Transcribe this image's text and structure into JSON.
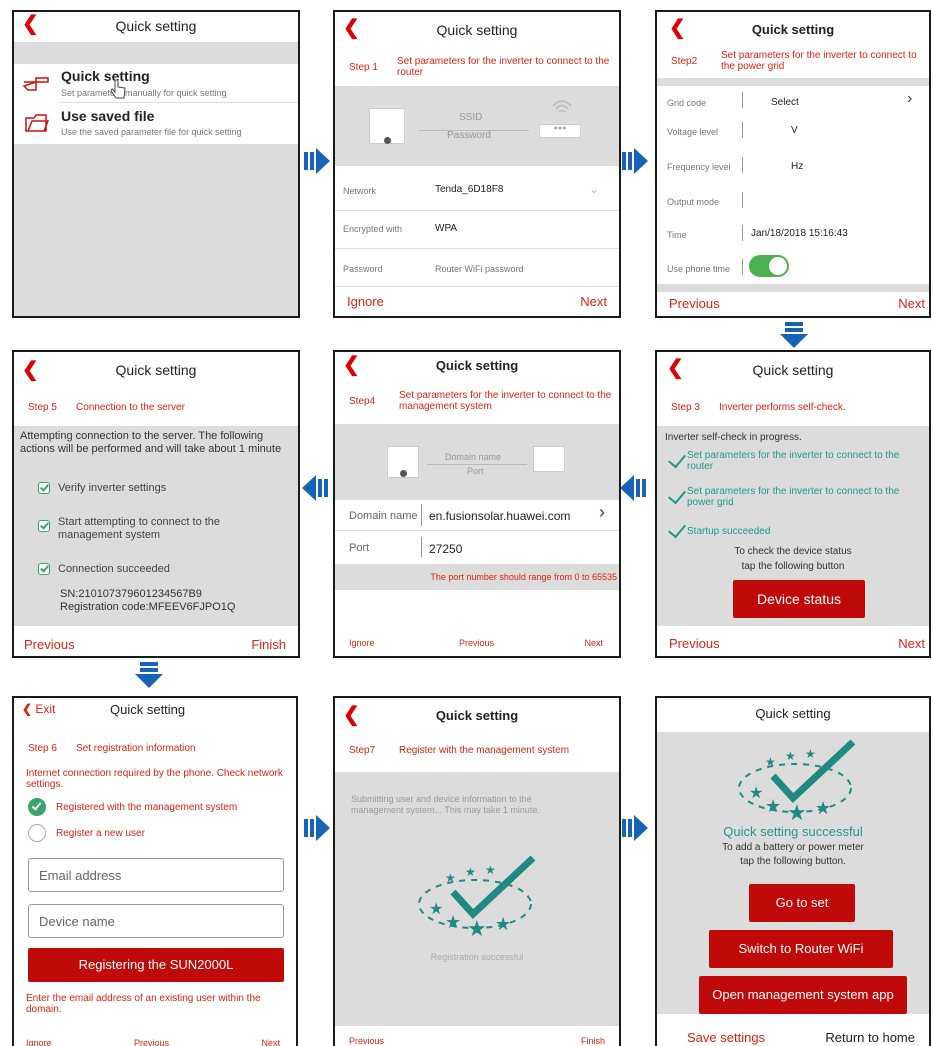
{
  "colors": {
    "accent": "#d21",
    "brand_red": "#c00a0a",
    "teal": "#1e9a8a",
    "toggle_green": "#4cb050",
    "arrow_blue": "#1664b8"
  },
  "s1": {
    "title": "Quick setting",
    "opt1_title": "Quick setting",
    "opt1_sub": "Set parameters manually for quick setting",
    "opt2_title": "Use saved file",
    "opt2_sub": "Use the saved parameter file for quick setting"
  },
  "s2": {
    "title": "Quick setting",
    "step": "Step 1",
    "step_desc": "Set parameters for the inverter to connect to the router",
    "ssid": "SSID",
    "password_lbl": "Password",
    "network_lbl": "Network",
    "network_val": "Tenda_6D18F8",
    "enc_lbl": "Encrypted with",
    "enc_val": "WPA",
    "pwd_lbl": "Password",
    "pwd_ph": "Router WiFi password",
    "ignore": "Ignore",
    "next": "Next"
  },
  "s3": {
    "title": "Quick setting",
    "step": "Step2",
    "step_desc": "Set parameters for the inverter to connect to the power grid",
    "grid_lbl": "Grid code",
    "grid_val": "Select",
    "volt_lbl": "Voltage level",
    "volt_unit": "V",
    "freq_lbl": "Frequency level",
    "freq_unit": "Hz",
    "out_lbl": "Output mode",
    "time_lbl": "Time",
    "time_val": "Jan/18/2018 15:16:43",
    "phone_lbl": "Use phone time",
    "prev": "Previous",
    "next": "Next"
  },
  "s4": {
    "title": "Quick setting",
    "step": "Step 5",
    "step_desc": "Connection to the server",
    "intro": "Attempting connection to the server. The following actions will be performed and will take about 1 minute",
    "i1": "Verify inverter settings",
    "i2": "Start attempting to connect to the management system",
    "i3": "Connection succeeded",
    "sn": "SN:210107379601234567B9",
    "reg": "Registration code:MFEEV6FJPO1Q",
    "prev": "Previous",
    "finish": "Finish"
  },
  "s5": {
    "title": "Quick setting",
    "step": "Step4",
    "step_desc": "Set parameters for the inverter to connect to the management system",
    "dn": "Domain name",
    "port_c": "Port",
    "domain_lbl": "Domain name",
    "domain_val": "en.fusionsolar.huawei.com",
    "port_lbl": "Port",
    "port_val": "27250",
    "hint": "The port number should range from 0 to 65535",
    "ignore": "Ignore",
    "prev": "Previous",
    "next": "Next"
  },
  "s6": {
    "title": "Quick setting",
    "step": "Step 3",
    "step_desc": "Inverter performs self-check.",
    "progress": "Inverter self-check in progress.",
    "c1": "Set parameters for the inverter to connect to the router",
    "c2": "Set parameters for the inverter to connect to the power grid",
    "c3": "Startup succeeded",
    "check1": "To check the device status",
    "check2": "tap the following button",
    "btn": "Device status",
    "prev": "Previous",
    "next": "Next"
  },
  "s7": {
    "exit": "Exit",
    "title": "Quick setting",
    "step": "Step 6",
    "step_desc": "Set registration information",
    "warn": "Internet connection required by the phone. Check network settings.",
    "r1": "Registered with the management system",
    "r2": "Register a new user",
    "email_ph": "Email address",
    "device_ph": "Device name",
    "btn": "Registering the SUN2000L",
    "hint": "Enter the email address of an existing user within the domain.",
    "ignore": "Ignore",
    "prev": "Previous",
    "next": "Next"
  },
  "s8": {
    "title": "Quick setting",
    "step": "Step7",
    "step_desc": "Register with the management system",
    "submit": "Submitting user and device information to the management system... This may take 1 minute.",
    "success": "Registration successful",
    "prev": "Previous",
    "finish": "Finish"
  },
  "s9": {
    "title": "Quick setting",
    "success": "Quick setting successful",
    "add1": "To add a battery or power meter",
    "add2": "tap the following button.",
    "go": "Go to set",
    "switch": "Switch to Router WiFi",
    "open": "Open management system app",
    "save": "Save settings",
    "home": "Return to home"
  }
}
